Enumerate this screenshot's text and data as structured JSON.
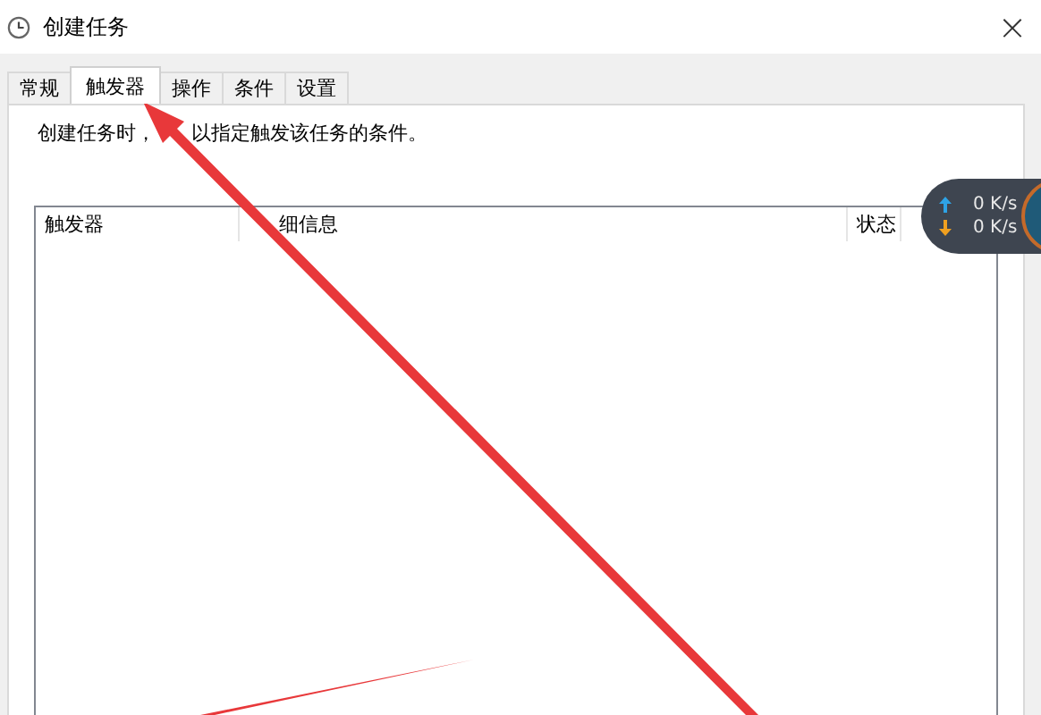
{
  "window": {
    "title": "创建任务",
    "close": "×"
  },
  "tabs": [
    {
      "label": "常规",
      "selected": false
    },
    {
      "label": "触发器",
      "selected": true
    },
    {
      "label": "操作",
      "selected": false
    },
    {
      "label": "条件",
      "selected": false
    },
    {
      "label": "设置",
      "selected": false
    }
  ],
  "description": [
    "创建任务时，",
    "以指定触发该任务的条件。"
  ],
  "table": {
    "columns": [
      "触发器",
      "细信息",
      "状态"
    ]
  },
  "network_widget": {
    "upload": "0 K/s",
    "download": "0 K/s"
  }
}
